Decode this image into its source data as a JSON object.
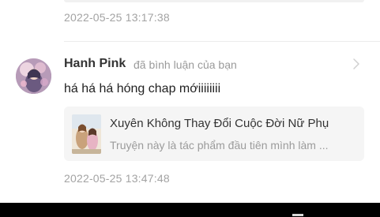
{
  "previous_item": {
    "timestamp": "2022-05-25 13:17:38"
  },
  "comment": {
    "user_name": "Hanh Pink",
    "action": "đã bình luận của bạn",
    "text": "há há há hóng chap mớiiiiiiii",
    "timestamp": "2022-05-25 13:47:48",
    "story": {
      "title": "Xuyên Không Thay Đổi Cuộc Đời Nữ Phụ",
      "description": "Truyện này là tác phẩm đầu tiên mình làm ..."
    }
  },
  "icons": {
    "chevron": "chevron-right-icon",
    "nav_back": "nav-back-icon",
    "nav_home": "nav-home-icon",
    "nav_recents": "nav-recents-icon"
  },
  "colors": {
    "background": "#ffffff",
    "card_background": "#f5f5f5",
    "secondary_text": "#a3a3a3",
    "primary_text": "#333333",
    "nav_bar": "#000000"
  }
}
